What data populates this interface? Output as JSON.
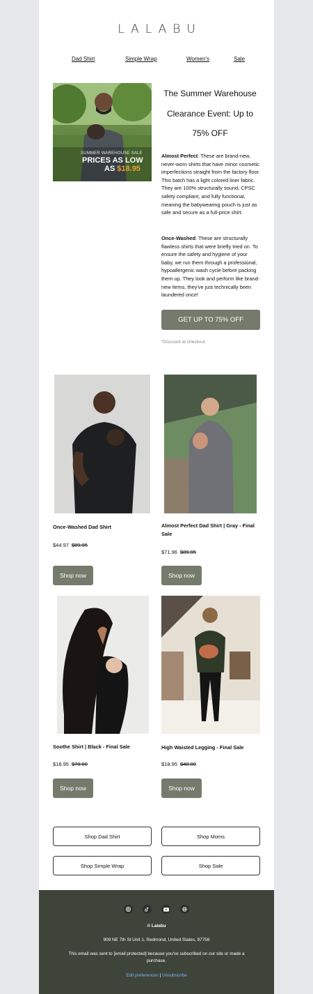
{
  "brand": {
    "logo": "LALABU"
  },
  "nav": {
    "items": [
      "Dad Shirt",
      "Simple Wrap",
      "Women's",
      "Sale"
    ]
  },
  "hero": {
    "image_overlay": {
      "line1": "SUMMER WAREHOUSE SALE",
      "line2": "PRICES AS LOW",
      "line3_prefix": "AS",
      "line3_price": "$18.95"
    },
    "headline": [
      "The Summer Warehouse",
      "Clearance Event: Up to",
      "75% OFF"
    ],
    "almost_perfect": {
      "label": "Almost Perfect",
      "text": ": These are brand-new, never-worn shirts that have minor cosmetic imperfections straight from the factory floor. This batch has a light colored liner fabric. They are 100% structurally sound, CPSC safety compliant, and fully functional, meaning the babywearing pouch is just as safe and secure as a full-price shirt."
    },
    "once_washed": {
      "label": "Once-Washed",
      "text": ": These are structurally flawless shirts that were briefly tried on. To ensure the safety and hygiene of your baby, we run them through a professional, hypoallergenic wash cycle before packing them up. They look and perform like brand-new items, they've just technically been laundered once!"
    },
    "cta_label": "GET UP TO 75% OFF",
    "disclaimer": "*Discount at checkout"
  },
  "products": [
    {
      "title": "Once-Washed Dad Shirt",
      "price": "$44.97",
      "original_price": "$89.95",
      "button": "Shop now"
    },
    {
      "title": "Almost Perfect Dad Shirt | Gray - Final Sale",
      "price": "$71.96",
      "original_price": "$89.95",
      "button": "Shop now"
    },
    {
      "title": "Soothe Shirt | Black - Final Sale",
      "price": "$18.95",
      "original_price": "$78.00",
      "button": "Shop now"
    },
    {
      "title": "High Waisted Legging - Final Sale",
      "price": "$18.95",
      "original_price": "$48.00",
      "button": "Shop now"
    }
  ],
  "category_buttons": [
    "Shop Dad Shirt",
    "Shop Moms",
    "Shop Simple Wrap",
    "Shop Sale"
  ],
  "footer": {
    "social_icons": [
      "instagram-icon",
      "tiktok-icon",
      "youtube-icon",
      "globe-icon"
    ],
    "copyright": "© Lalabu",
    "address": "909 NE 7th St Unit 1, Redmond, United States, 97756",
    "notice": "This email was sent to [email protected] because you've subscribed on our site or made a purchase.",
    "edit_preferences": "Edit preferences",
    "separator": "|",
    "unsubscribe": "Unsubscribe"
  },
  "colors": {
    "accent": "#757b6c",
    "footer_bg": "#3f443a",
    "page_bg": "#e5e7ea",
    "link": "#78b5ff",
    "price_highlight": "#e7a33a"
  }
}
